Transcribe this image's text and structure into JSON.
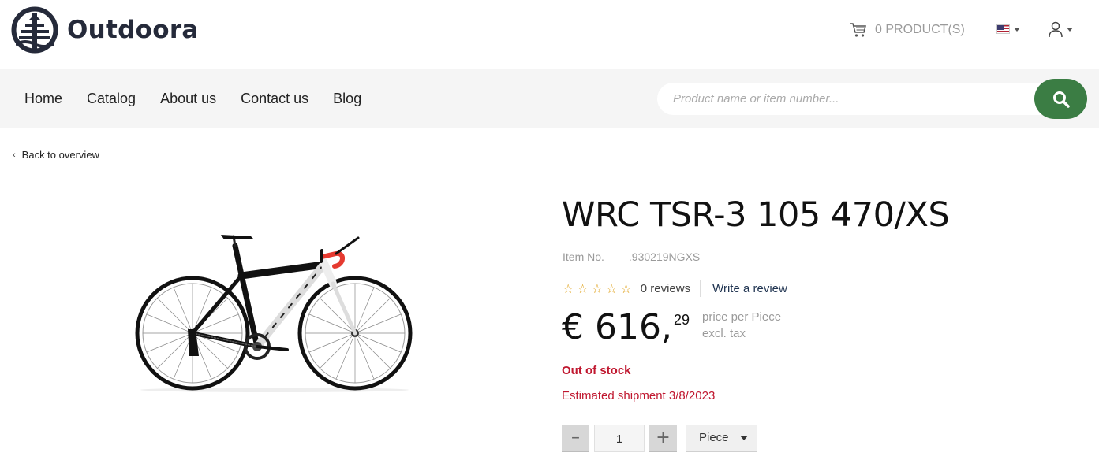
{
  "brand": {
    "name": "Outdoora"
  },
  "header": {
    "cart_label": "0 PRODUCT(S)",
    "cart_icon": "cart-icon",
    "language_icon": "us-flag-icon",
    "user_icon": "user-icon"
  },
  "nav": {
    "items": [
      {
        "label": "Home"
      },
      {
        "label": "Catalog"
      },
      {
        "label": "About us"
      },
      {
        "label": "Contact us"
      },
      {
        "label": "Blog"
      }
    ]
  },
  "search": {
    "placeholder": "Product name or item number...",
    "value": "",
    "button_icon": "search-icon",
    "accent": "#3b7d44"
  },
  "back_link": "Back to overview",
  "product": {
    "title": "WRC TSR-3 105 470/XS",
    "item_no_label": "Item No.",
    "item_no": ".930219NGXS",
    "rating": 0,
    "reviews": "0 reviews",
    "write_review": "Write a review",
    "price_main": "€ 616,",
    "price_cents": "29",
    "price_per": "price per Piece",
    "price_tax": "excl. tax",
    "stock_status": "Out of stock",
    "shipment": "Estimated shipment 3/8/2023",
    "status_color": "#c0172f"
  },
  "quantity": {
    "value": "1",
    "unit": "Piece",
    "decrease_label": "–",
    "increase_label": "+"
  }
}
